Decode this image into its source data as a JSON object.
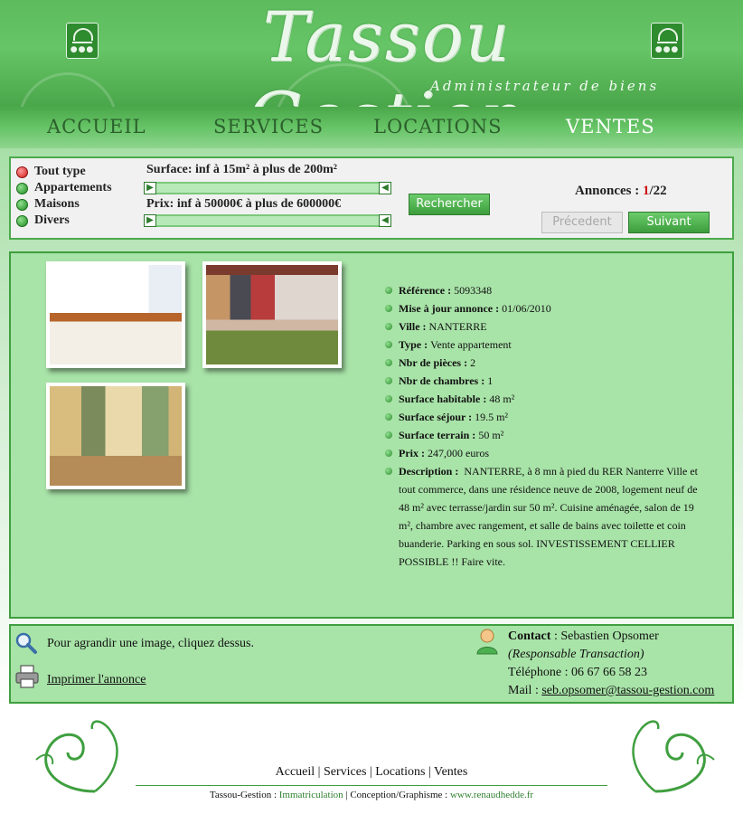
{
  "header": {
    "title": "Tassou Gestion",
    "subtitle": "Administrateur de biens"
  },
  "nav": {
    "items": [
      {
        "label": "ACCUEIL",
        "active": false
      },
      {
        "label": "SERVICES",
        "active": false
      },
      {
        "label": "LOCATIONS",
        "active": false
      },
      {
        "label": "VENTES",
        "active": true
      }
    ]
  },
  "search": {
    "types": [
      {
        "label": "Tout type",
        "selected": true
      },
      {
        "label": "Appartements",
        "selected": false
      },
      {
        "label": "Maisons",
        "selected": false
      },
      {
        "label": "Divers",
        "selected": false
      }
    ],
    "surface_label": "Surface: inf à 15m² à plus de 200m²",
    "price_label": "Prix: inf à 50000€ à plus de 600000€",
    "search_button": "Rechercher",
    "annonces_label": "Annonces :",
    "current": "1",
    "total_sep": "/22",
    "prev_button": "Précedent",
    "next_button": "Suivant"
  },
  "listing": {
    "fields": [
      {
        "label": "Référence :",
        "value": "5093348"
      },
      {
        "label": "Mise à jour annonce :",
        "value": "01/06/2010"
      },
      {
        "label": "Ville :",
        "value": "NANTERRE"
      },
      {
        "label": "Type :",
        "value": "Vente appartement"
      },
      {
        "label": "Nbr de pièces :",
        "value": "2"
      },
      {
        "label": "Nbr de chambres :",
        "value": "1"
      },
      {
        "label": "Surface habitable :",
        "value": "48 m²"
      },
      {
        "label": "Surface séjour :",
        "value": "19.5 m²"
      },
      {
        "label": "Surface terrain :",
        "value": "50 m²"
      },
      {
        "label": "Prix :",
        "value": "247,000 euros"
      }
    ],
    "description_label": "Description :",
    "description": "NANTERRE, à 8 mn à pied du RER Nanterre Ville et tout commerce, dans une résidence neuve de 2008, logement neuf de 48 m² avec terrasse/jardin sur 50 m². Cuisine aménagée, salon de 19 m², chambre avec rangement, et salle de bains avec toilette et coin buanderie. Parking en sous sol. INVESTISSEMENT CELLIER POSSIBLE !! Faire vite."
  },
  "info": {
    "zoom_hint": "Pour agrandir une image, cliquez dessus.",
    "print_link": "Imprimer l'annonce",
    "contact_label": "Contact",
    "contact_name": " : Sebastien Opsomer",
    "contact_role": "(Responsable Transaction)",
    "phone": "Téléphone : 06 67 66 58 23",
    "mail_label": "Mail : ",
    "mail": "seb.opsomer@tassou-gestion.com"
  },
  "footer": {
    "links": [
      "Accueil",
      "Services",
      "Locations",
      "Ventes"
    ],
    "sep": " | ",
    "credit_prefix": "Tassou-Gestion : ",
    "credit_link": "Immatriculation",
    "credit_mid": " | Conception/Graphisme : ",
    "credit_site": "www.renaudhedde.fr"
  },
  "colors": {
    "brand_green": "#4caa4c",
    "panel_green": "#a8e3a8",
    "counter_red": "#cc1111"
  }
}
